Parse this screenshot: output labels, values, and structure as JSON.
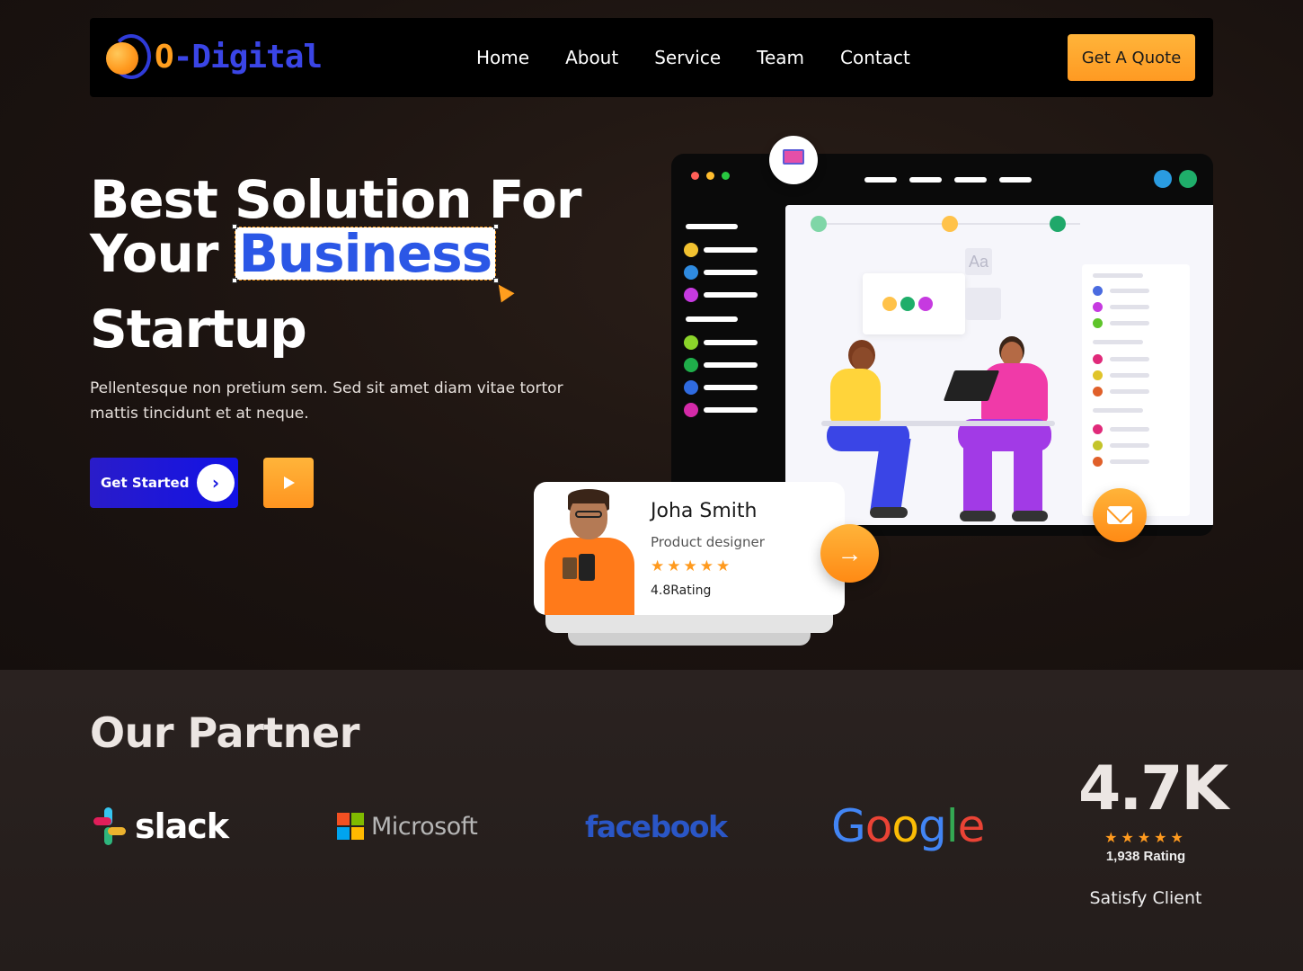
{
  "brand": {
    "logo_prefix": "O",
    "logo_rest": "-Digital"
  },
  "nav": {
    "items": [
      "Home",
      "About",
      "Service",
      "Team",
      "Contact"
    ],
    "cta": "Get A Quote"
  },
  "hero": {
    "line1": "Best Solution For",
    "line2_pre": "Your",
    "line2_highlight": "Business",
    "line3": "Startup",
    "description": "Pellentesque non pretium sem. Sed sit amet diam vitae tortor mattis tincidunt et at neque.",
    "primary_button": "Get Started",
    "primary_button_icon": "chevron-right-icon",
    "secondary_button_icon": "play-icon"
  },
  "profile_card": {
    "name": "Joha Smith",
    "role": "Product designer",
    "stars": "★★★★★",
    "rating": "4.8Rating"
  },
  "partners": {
    "title": "Our Partner",
    "logos": [
      "slack",
      "Microsoft",
      "facebook",
      "Google"
    ]
  },
  "stats": {
    "value": "4.7K",
    "stars": "★★★★★",
    "rating_count": "1,938 Rating",
    "label": "Satisfy Client"
  },
  "colors": {
    "accent_orange": "#ff9e1e",
    "accent_blue": "#2b57e6",
    "button_blue": "#1212e6",
    "background": "#1a1311"
  }
}
